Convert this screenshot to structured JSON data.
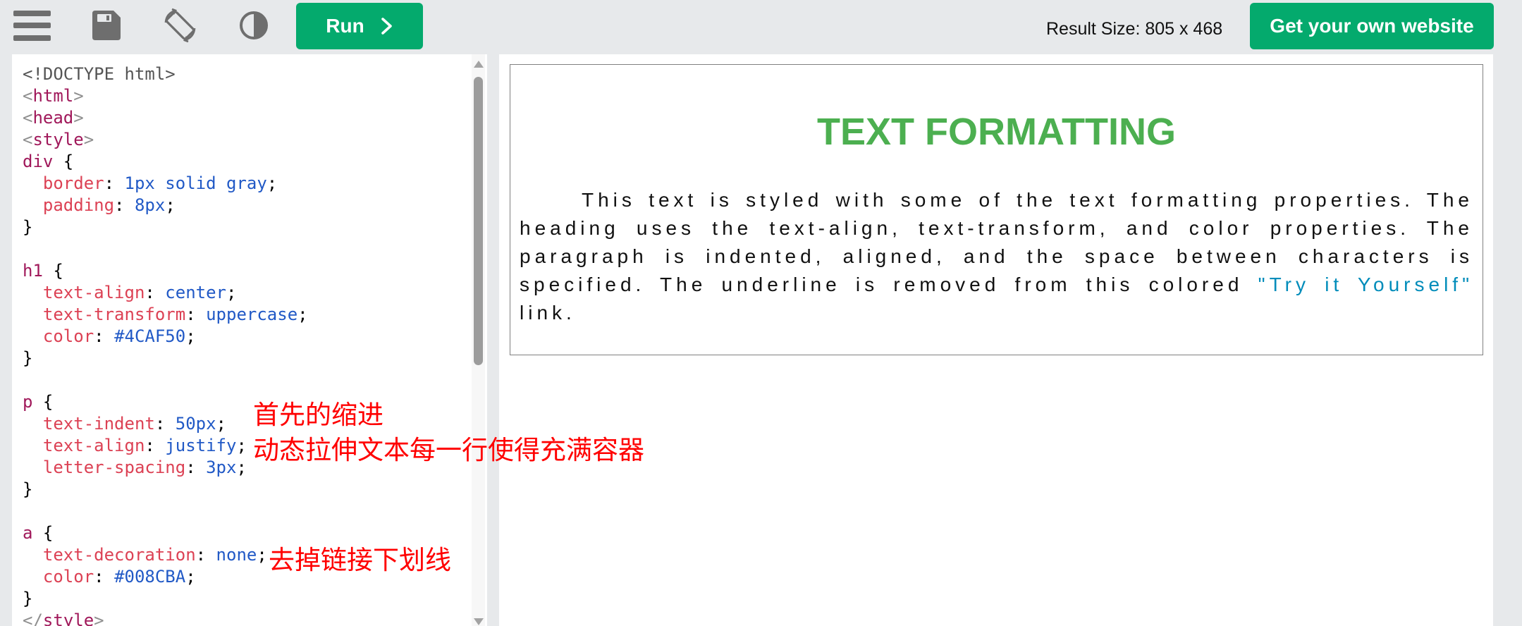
{
  "colors": {
    "accent": "#04AA6D",
    "heading": "#4CAF50",
    "link": "#008CBA",
    "annotation": "#FF0000",
    "toolbar_bg": "#E7E9EB",
    "icon": "#6E6E6E"
  },
  "toolbar": {
    "icons": [
      "menu-icon",
      "save-icon",
      "rotate-icon",
      "contrast-icon"
    ],
    "run_label": "Run",
    "run_icon": "chevron-right-icon",
    "result_size": "Result Size: 805 x 468",
    "get_website_label": "Get your own website"
  },
  "code": {
    "lines": [
      [
        {
          "t": "<!DOCTYPE html>",
          "c": "#555555"
        }
      ],
      [
        {
          "t": "<",
          "c": "#8f8f8f"
        },
        {
          "t": "html",
          "c": "#a0185a"
        },
        {
          "t": ">",
          "c": "#8f8f8f"
        }
      ],
      [
        {
          "t": "<",
          "c": "#8f8f8f"
        },
        {
          "t": "head",
          "c": "#a0185a"
        },
        {
          "t": ">",
          "c": "#8f8f8f"
        }
      ],
      [
        {
          "t": "<",
          "c": "#8f8f8f"
        },
        {
          "t": "style",
          "c": "#a0185a"
        },
        {
          "t": ">",
          "c": "#8f8f8f"
        }
      ],
      [
        {
          "t": "div",
          "c": "#a0185a"
        },
        {
          "t": " {",
          "c": "#000000"
        }
      ],
      [
        {
          "t": "  border",
          "c": "#dc4154"
        },
        {
          "t": ": ",
          "c": "#000000"
        },
        {
          "t": "1px solid gray",
          "c": "#2159c6"
        },
        {
          "t": ";",
          "c": "#000000"
        }
      ],
      [
        {
          "t": "  padding",
          "c": "#dc4154"
        },
        {
          "t": ": ",
          "c": "#000000"
        },
        {
          "t": "8px",
          "c": "#2159c6"
        },
        {
          "t": ";",
          "c": "#000000"
        }
      ],
      [
        {
          "t": "}",
          "c": "#000000"
        }
      ],
      [],
      [
        {
          "t": "h1",
          "c": "#a0185a"
        },
        {
          "t": " {",
          "c": "#000000"
        }
      ],
      [
        {
          "t": "  text-align",
          "c": "#dc4154"
        },
        {
          "t": ": ",
          "c": "#000000"
        },
        {
          "t": "center",
          "c": "#2159c6"
        },
        {
          "t": ";",
          "c": "#000000"
        }
      ],
      [
        {
          "t": "  text-transform",
          "c": "#dc4154"
        },
        {
          "t": ": ",
          "c": "#000000"
        },
        {
          "t": "uppercase",
          "c": "#2159c6"
        },
        {
          "t": ";",
          "c": "#000000"
        }
      ],
      [
        {
          "t": "  color",
          "c": "#dc4154"
        },
        {
          "t": ": ",
          "c": "#000000"
        },
        {
          "t": "#4CAF50",
          "c": "#2159c6"
        },
        {
          "t": ";",
          "c": "#000000"
        }
      ],
      [
        {
          "t": "}",
          "c": "#000000"
        }
      ],
      [],
      [
        {
          "t": "p",
          "c": "#a0185a"
        },
        {
          "t": " {",
          "c": "#000000"
        }
      ],
      [
        {
          "t": "  text-indent",
          "c": "#dc4154"
        },
        {
          "t": ": ",
          "c": "#000000"
        },
        {
          "t": "50px",
          "c": "#2159c6"
        },
        {
          "t": ";",
          "c": "#000000"
        }
      ],
      [
        {
          "t": "  text-align",
          "c": "#dc4154"
        },
        {
          "t": ": ",
          "c": "#000000"
        },
        {
          "t": "justify",
          "c": "#2159c6"
        },
        {
          "t": ";",
          "c": "#000000"
        }
      ],
      [
        {
          "t": "  letter-spacing",
          "c": "#dc4154"
        },
        {
          "t": ": ",
          "c": "#000000"
        },
        {
          "t": "3px",
          "c": "#2159c6"
        },
        {
          "t": ";",
          "c": "#000000"
        }
      ],
      [
        {
          "t": "}",
          "c": "#000000"
        }
      ],
      [],
      [
        {
          "t": "a",
          "c": "#a0185a"
        },
        {
          "t": " {",
          "c": "#000000"
        }
      ],
      [
        {
          "t": "  text-decoration",
          "c": "#dc4154"
        },
        {
          "t": ": ",
          "c": "#000000"
        },
        {
          "t": "none",
          "c": "#2159c6"
        },
        {
          "t": ";",
          "c": "#000000"
        }
      ],
      [
        {
          "t": "  color",
          "c": "#dc4154"
        },
        {
          "t": ": ",
          "c": "#000000"
        },
        {
          "t": "#008CBA",
          "c": "#2159c6"
        },
        {
          "t": ";",
          "c": "#000000"
        }
      ],
      [
        {
          "t": "}",
          "c": "#000000"
        }
      ],
      [
        {
          "t": "</",
          "c": "#8f8f8f"
        },
        {
          "t": "style",
          "c": "#a0185a"
        },
        {
          "t": ">",
          "c": "#8f8f8f"
        }
      ]
    ]
  },
  "result": {
    "heading": "TEXT FORMATTING",
    "paragraph_text": "This text is styled with some of the text formatting properties. The heading uses the text-align, text-transform, and color properties. The paragraph is indented, aligned, and the space between characters is specified. The underline is removed from this colored ",
    "link_text": "\"Try it Yourself\"",
    "paragraph_tail": " link."
  },
  "annotations": [
    "首先的缩进",
    "动态拉伸文本每一行使得充满容器",
    "去掉链接下划线"
  ]
}
